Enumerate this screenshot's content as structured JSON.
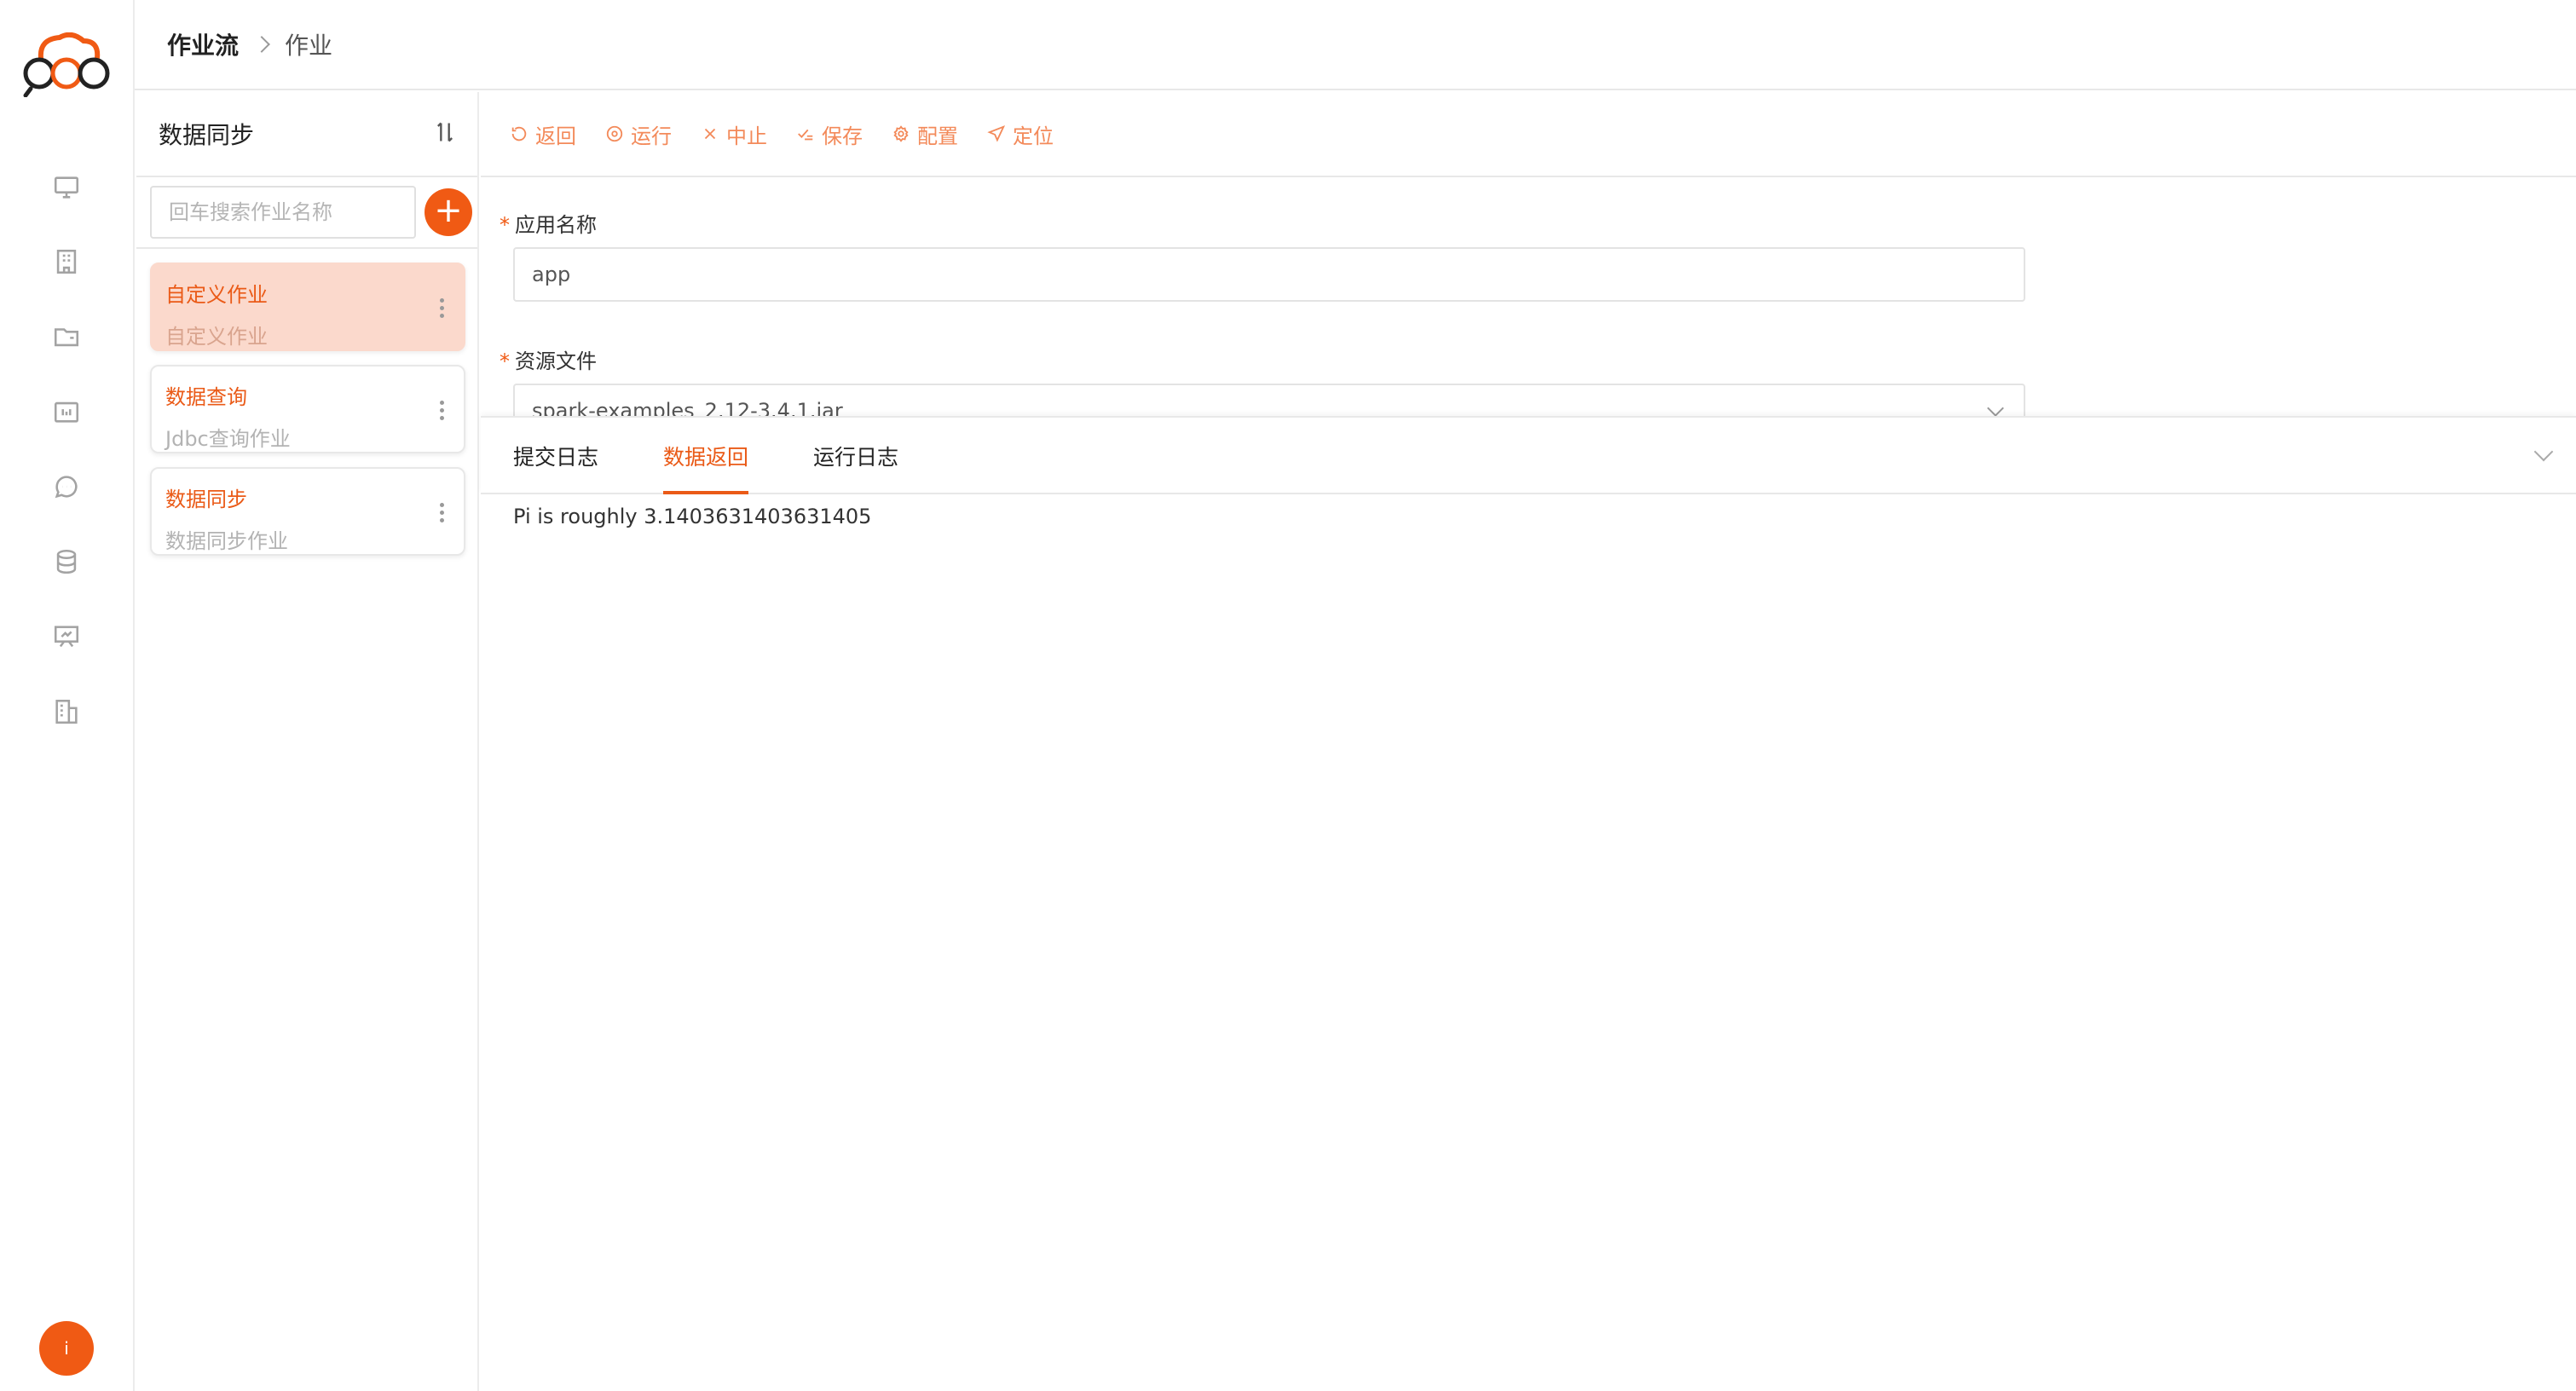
{
  "breadcrumb": {
    "root": "作业流",
    "current": "作业"
  },
  "sidebar_icons": [
    "monitor-icon",
    "building-icon",
    "folder-icon",
    "calendar-icon",
    "chat-icon",
    "database-icon",
    "presentation-icon",
    "office-icon"
  ],
  "user": {
    "avatar_text": "i"
  },
  "job_panel": {
    "title": "数据同步",
    "search_placeholder": "回车搜索作业名称",
    "add_label": "+",
    "jobs": [
      {
        "name": "自定义作业",
        "type": "自定义作业",
        "active": true
      },
      {
        "name": "数据查询",
        "type": "Jdbc查询作业",
        "active": false
      },
      {
        "name": "数据同步",
        "type": "数据同步作业",
        "active": false
      }
    ]
  },
  "toolbar": {
    "back": "返回",
    "run": "运行",
    "stop": "中止",
    "save": "保存",
    "config": "配置",
    "locate": "定位"
  },
  "form": {
    "app_name_label": "应用名称",
    "app_name_value": "app",
    "resource_label": "资源文件",
    "resource_value": "spark-examples_2.12-3.4.1.jar",
    "required_mark": "*"
  },
  "tabs": [
    {
      "label": "提交日志",
      "active": false
    },
    {
      "label": "数据返回",
      "active": true
    },
    {
      "label": "运行日志",
      "active": false
    }
  ],
  "output_text": "Pi is roughly 3.1403631403631405",
  "colors": {
    "accent": "#f05a14",
    "accent_text": "#ea5a17",
    "active_card": "#fbd9cc",
    "toolbar_text": "#f38a5a"
  }
}
